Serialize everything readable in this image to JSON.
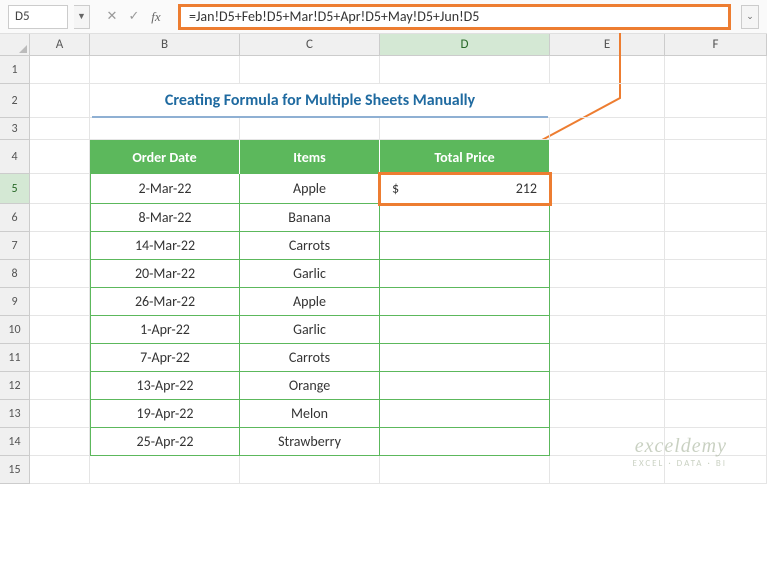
{
  "name_box": "D5",
  "formula": "=Jan!D5+Feb!D5+Mar!D5+Apr!D5+May!D5+Jun!D5",
  "columns": [
    "A",
    "B",
    "C",
    "D",
    "E",
    "F"
  ],
  "title": "Creating Formula for Multiple Sheets Manually",
  "headers": {
    "date": "Order Date",
    "items": "Items",
    "price": "Total Price"
  },
  "rows": [
    {
      "r": 5,
      "date": "2-Mar-22",
      "item": "Apple",
      "price_sym": "$",
      "price_val": "212"
    },
    {
      "r": 6,
      "date": "8-Mar-22",
      "item": "Banana"
    },
    {
      "r": 7,
      "date": "14-Mar-22",
      "item": "Carrots"
    },
    {
      "r": 8,
      "date": "20-Mar-22",
      "item": "Garlic"
    },
    {
      "r": 9,
      "date": "26-Mar-22",
      "item": "Apple"
    },
    {
      "r": 10,
      "date": "1-Apr-22",
      "item": "Garlic"
    },
    {
      "r": 11,
      "date": "7-Apr-22",
      "item": "Carrots"
    },
    {
      "r": 12,
      "date": "13-Apr-22",
      "item": "Orange"
    },
    {
      "r": 13,
      "date": "19-Apr-22",
      "item": "Melon"
    },
    {
      "r": 14,
      "date": "25-Apr-22",
      "item": "Strawberry"
    }
  ],
  "watermark": {
    "main": "exceldemy",
    "sub": "EXCEL · DATA · BI"
  }
}
